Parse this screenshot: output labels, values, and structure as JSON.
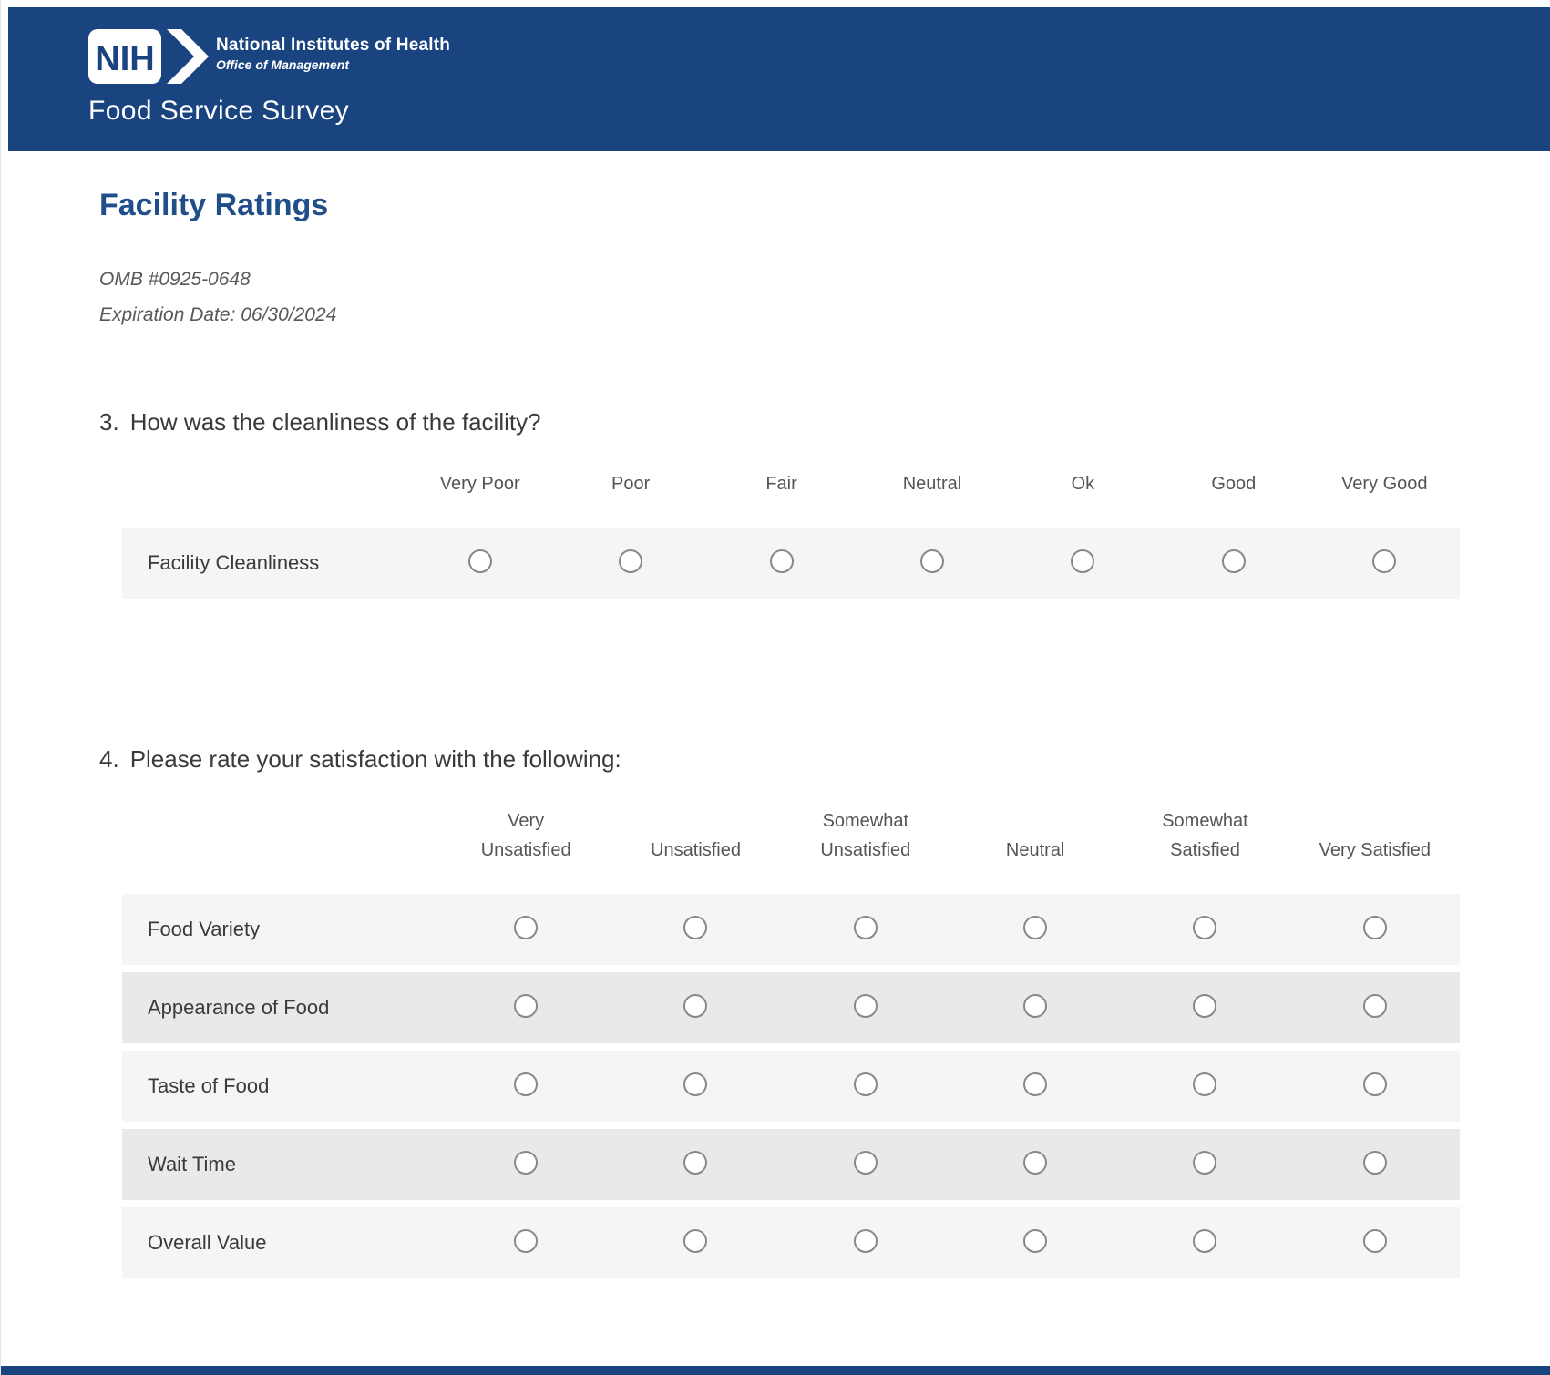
{
  "header": {
    "brand": {
      "logo_acronym": "NIH",
      "org_name": "National Institutes of Health",
      "org_sub": "Office of Management"
    },
    "survey_title": "Food Service Survey"
  },
  "page": {
    "section_title": "Facility Ratings",
    "omb_number": "OMB #0925-0648",
    "expiration": "Expiration Date: 06/30/2024"
  },
  "questions": [
    {
      "number": "3.",
      "text": "How was the cleanliness of the facility?",
      "columns": [
        "Very Poor",
        "Poor",
        "Fair",
        "Neutral",
        "Ok",
        "Good",
        "Very Good"
      ],
      "rows": [
        "Facility Cleanliness"
      ],
      "selected": null
    },
    {
      "number": "4.",
      "text": "Please rate your satisfaction with the following:",
      "columns": [
        "Very\nUnsatisfied",
        "Unsatisfied",
        "Somewhat\nUnsatisfied",
        "Neutral",
        "Somewhat\nSatisfied",
        "Very Satisfied"
      ],
      "rows": [
        "Food Variety",
        "Appearance of Food",
        "Taste of Food",
        "Wait Time",
        "Overall Value"
      ],
      "selected": null
    }
  ],
  "colors": {
    "header_bg": "#1a4480",
    "section_title": "#1f4e8b",
    "row_light": "#f5f5f5",
    "row_dark": "#e9e9e9",
    "radio_border": "#8a8886"
  }
}
